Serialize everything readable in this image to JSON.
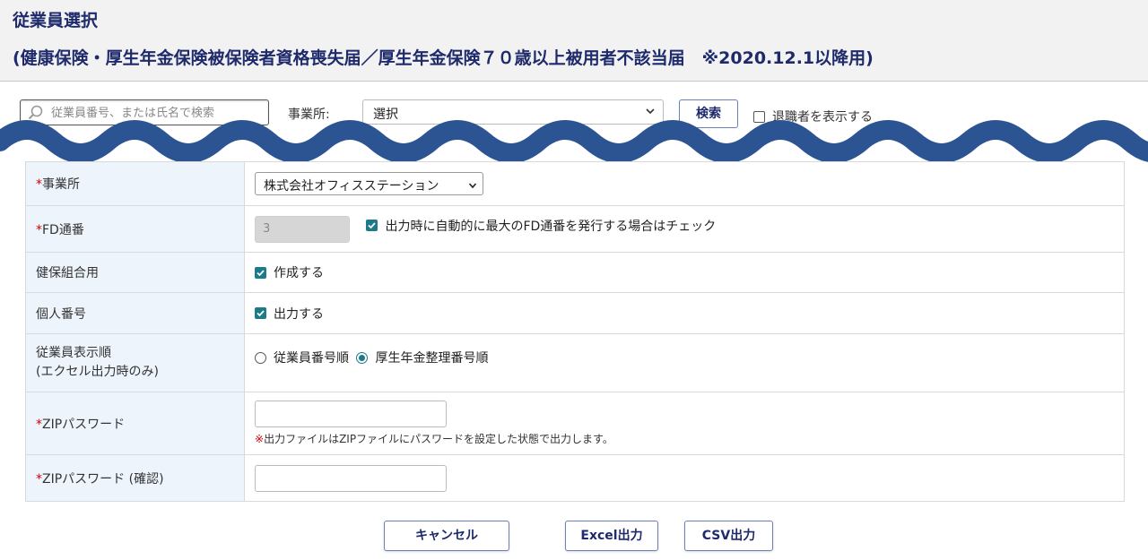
{
  "header": {
    "title": "従業員選択",
    "subtitle": "(健康保険・厚生年金保険被保険者資格喪失届／厚生年金保険７０歳以上被用者不該当届　※2020.12.1以降用)"
  },
  "search": {
    "placeholder": "従業員番号、または氏名で検索",
    "office_label": "事業所:",
    "office_value": "選択",
    "search_button": "検索",
    "show_retired_label": "退職者を表示する"
  },
  "form": {
    "office": {
      "required_mark": "*",
      "label": "事業所",
      "value": "株式会社オフィスステーション"
    },
    "fd_number": {
      "required_mark": "*",
      "label": "FD通番",
      "value": "3",
      "auto_check_label": "出力時に自動的に最大のFD通番を発行する場合はチェック"
    },
    "health_union": {
      "label": "健保組合用",
      "check_label": "作成する"
    },
    "personal_number": {
      "label": "個人番号",
      "check_label": "出力する"
    },
    "display_order": {
      "label_line1": "従業員表示順",
      "label_line2": "(エクセル出力時のみ)",
      "option1": "従業員番号順",
      "option2": "厚生年金整理番号順"
    },
    "zip_password": {
      "required_mark": "*",
      "label": "ZIPパスワード",
      "note_mark": "※",
      "note": "出力ファイルはZIPファイルにパスワードを設定した状態で出力します。"
    },
    "zip_password_confirm": {
      "required_mark": "*",
      "label": "ZIPパスワード (確認)"
    }
  },
  "buttons": {
    "cancel": "キャンセル",
    "excel": "Excel出力",
    "csv": "CSV出力"
  },
  "colors": {
    "title": "#1e2a6b",
    "wave": "#2c5493",
    "required": "#d40000",
    "checkbox": "#1d7a8a",
    "label_bg": "#eef4fc"
  }
}
